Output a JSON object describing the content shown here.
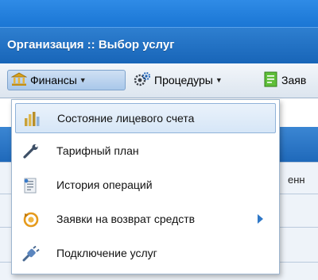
{
  "window": {
    "title": "Организация :: Выбор услуг"
  },
  "toolbar": {
    "finance_label": "Финансы",
    "procedures_label": "Процедуры",
    "requests_label": "Заяв"
  },
  "background": {
    "cell_text": "енн"
  },
  "finance_menu": {
    "items": [
      {
        "label": "Состояние лицевого счета",
        "icon": "chart-bars-icon",
        "highlighted": true
      },
      {
        "label": "Тарифный план",
        "icon": "wrench-icon"
      },
      {
        "label": "История операций",
        "icon": "history-list-icon"
      },
      {
        "label": "Заявки на возврат средств",
        "icon": "refund-icon",
        "has_submenu": true
      },
      {
        "label": "Подключение услуг",
        "icon": "plug-icon"
      }
    ]
  },
  "colors": {
    "title_bar": "#1865b8",
    "accent": "#2f78c7",
    "menu_highlight": "#d6e6f7"
  }
}
